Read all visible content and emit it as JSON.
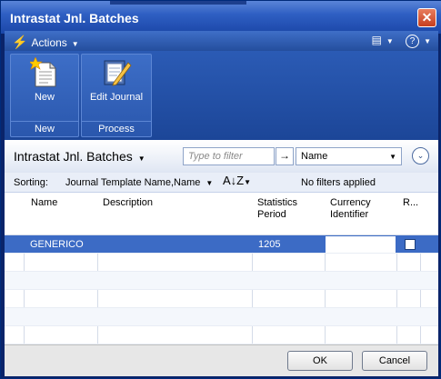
{
  "window": {
    "title": "Intrastat Jnl. Batches",
    "close_glyph": "✕"
  },
  "actions_bar": {
    "actions_label": "Actions",
    "view_glyph": "▤",
    "help_glyph": "?"
  },
  "ribbon": {
    "groups": [
      {
        "footer": "New",
        "buttons": [
          {
            "label": "New",
            "icon": "new-document-icon"
          }
        ]
      },
      {
        "footer": "Process",
        "buttons": [
          {
            "label": "Edit Journal",
            "icon": "edit-journal-icon"
          }
        ]
      }
    ]
  },
  "list_header": {
    "title": "Intrastat Jnl. Batches",
    "filter_placeholder": "Type to filter",
    "filter_field": "Name",
    "sorting_label": "Sorting:",
    "sorting_value": "Journal Template Name,Name",
    "sort_order_glyph": "A↓Z",
    "filter_status": "No filters applied"
  },
  "grid": {
    "columns": [
      "Name",
      "Description",
      "Statistics Period",
      "Currency Identifier",
      "R..."
    ],
    "rows": [
      {
        "name": "GENERICO",
        "description": "",
        "statistics_period": "1205",
        "currency_identifier": "",
        "r_checked": false
      }
    ]
  },
  "footer": {
    "ok_label": "OK",
    "cancel_label": "Cancel"
  },
  "colors": {
    "title_bar": "#2f5fc3",
    "ribbon": "#2b5bb5",
    "selected_row": "#3c6bc5"
  }
}
